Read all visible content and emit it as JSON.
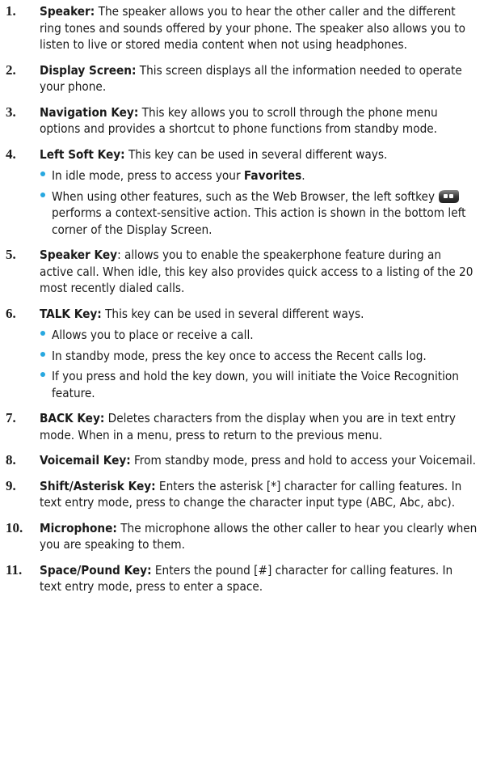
{
  "items": [
    {
      "num": "1.",
      "term": "Speaker:",
      "text": " The speaker allows you to hear the other caller and the different ring tones and sounds offered by your phone. The speaker also allows you to listen to live or stored media content when not using headphones."
    },
    {
      "num": "2.",
      "term": "Display Screen:",
      "text": " This screen displays all the information needed to operate your phone."
    },
    {
      "num": "3.",
      "term": "Navigation Key:",
      "text": " This key allows you to scroll through the phone menu options and provides a shortcut to phone functions from standby mode."
    },
    {
      "num": "4.",
      "term": "Left Soft Key:",
      "text": " This key can be used in several different ways.",
      "b1_pre": "In idle mode, press to access your ",
      "b1_bold": "Favorites",
      "b1_post": ".",
      "b2_pre": "When using other features, such as the Web Browser, the left softkey",
      "b2_post": " performs a context-sensitive action. This action is shown in the bottom left corner of the Display Screen."
    },
    {
      "num": "5.",
      "term": "Speaker Key",
      "text": ": allows you to enable the speakerphone feature during an active call. When idle, this key also provides quick access to a listing of the 20 most recently dialed calls."
    },
    {
      "num": "6.",
      "term": "TALK Key:",
      "text": " This key can be used in several different ways.",
      "bullets": [
        "Allows you to place or receive a call.",
        "In standby mode, press the key once to access the Recent calls log.",
        "If you press and hold the key down, you will initiate the Voice Recognition feature."
      ]
    },
    {
      "num": "7.",
      "term": "BACK Key:",
      "text": " Deletes characters from the display when you are in text entry mode. When in a menu, press to return to the previous menu."
    },
    {
      "num": "8.",
      "term": "Voicemail Key:",
      "text": " From standby mode, press and hold to access your Voicemail."
    },
    {
      "num": "9.",
      "term": "Shift/Asterisk Key:",
      "text": " Enters the asterisk [*] character for calling features. In text entry mode, press to change the character input type (ABC, Abc, abc)."
    },
    {
      "num": "10.",
      "term": "Microphone:",
      "text": " The microphone allows the other caller to hear you clearly when you are speaking to them."
    },
    {
      "num": "11.",
      "term": "Space/Pound Key:",
      "text": " Enters the pound [#] character for calling features. In text entry mode, press to enter a space."
    }
  ],
  "colors": {
    "bullet": "#27a8e0",
    "softkey": "#3a3a3a"
  },
  "icons": {
    "softkey": "left-softkey-icon"
  }
}
